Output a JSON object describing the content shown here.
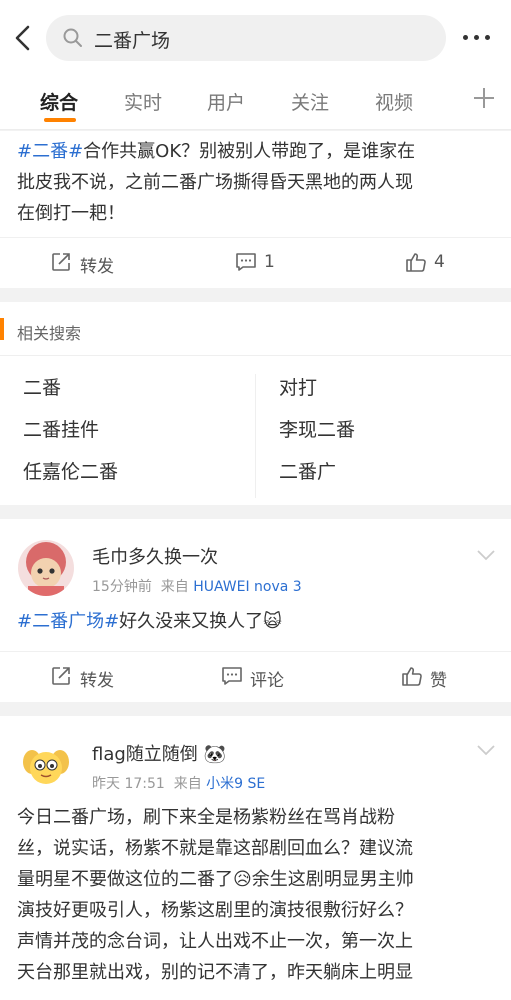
{
  "search": {
    "query": "二番广场"
  },
  "tabs": [
    {
      "label": "综合"
    },
    {
      "label": "实时"
    },
    {
      "label": "用户"
    },
    {
      "label": "关注"
    },
    {
      "label": "视频"
    }
  ],
  "post1": {
    "tag": "#二番#",
    "lines": [
      "合作共赢OK？别被别人带跑了，是谁家在",
      "批皮我不说，之前二番广场撕得昏天黑地的两人现",
      "在倒打一耙！"
    ],
    "repost_label": "转发",
    "comment_count": "1",
    "like_count": "4"
  },
  "related": {
    "title": "相关搜索",
    "items": [
      "二番",
      "对打",
      "二番挂件",
      "李现二番",
      "任嘉伦二番",
      "二番广"
    ]
  },
  "post2": {
    "username": "毛巾多久换一次",
    "time": "15分钟前",
    "from_label": "来自",
    "source": "HUAWEI nova 3",
    "tag": "#二番广场#",
    "text": "好久没来又换人了",
    "emoji": "🙀",
    "repost_label": "转发",
    "comment_label": "评论",
    "like_label": "赞"
  },
  "post3": {
    "username": "flag随立随倒",
    "username_emoji": "🐼",
    "time": "昨天 17:51",
    "from_label": "来自",
    "source": "小米9 SE",
    "lines": [
      "今日二番广场，刷下来全是杨紫粉丝在骂肖战粉",
      "丝，说实话，杨紫不就是靠这部剧回血么？建议流",
      "量明星不要做这位的二番了😥余生这剧明显男主帅",
      "演技好更吸引人，杨紫这剧里的演技很敷衍好么？",
      "声情并茂的念台词，让人出戏不止一次，第一次上",
      "天台那里就出戏，别的记不清了，昨天躺床上明显"
    ]
  },
  "colors": {
    "accent": "#ff8200",
    "link": "#2c6fd1"
  }
}
